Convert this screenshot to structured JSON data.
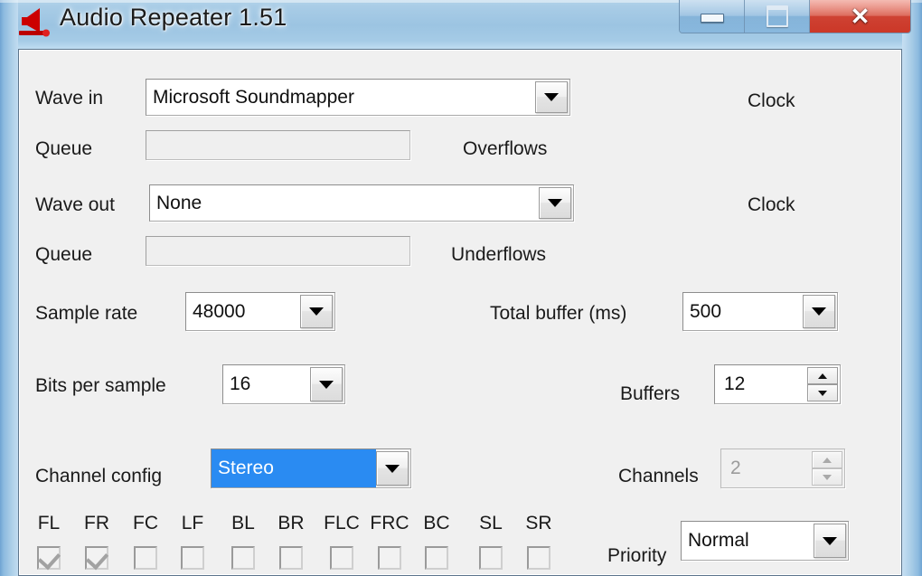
{
  "window": {
    "title": "Audio Repeater 1.51",
    "icon": "audio-repeater-icon",
    "buttons": {
      "minimize": "minimize-button",
      "maximize": "maximize-button",
      "close": "✕"
    }
  },
  "form": {
    "wave_in": {
      "label": "Wave in",
      "value": "Microsoft Soundmapper",
      "clock_label": "Clock",
      "queue_label": "Queue",
      "queue_value": "",
      "counter_label": "Overflows"
    },
    "wave_out": {
      "label": "Wave out",
      "value": "None",
      "clock_label": "Clock",
      "queue_label": "Queue",
      "queue_value": "",
      "counter_label": "Underflows"
    },
    "sample_rate": {
      "label": "Sample rate",
      "value": "48000"
    },
    "total_buffer": {
      "label": "Total buffer (ms)",
      "value": "500"
    },
    "bits_per_sample": {
      "label": "Bits per sample",
      "value": "16"
    },
    "buffers": {
      "label": "Buffers",
      "value": "12"
    },
    "channel_config": {
      "label": "Channel config",
      "value": "Stereo"
    },
    "channels": {
      "label": "Channels",
      "value": "2"
    },
    "priority": {
      "label": "Priority",
      "value": "Normal"
    },
    "channel_mask": {
      "items": [
        {
          "label": "FL",
          "checked": true
        },
        {
          "label": "FR",
          "checked": true
        },
        {
          "label": "FC",
          "checked": false
        },
        {
          "label": "LF",
          "checked": false
        },
        {
          "label": "BL",
          "checked": false
        },
        {
          "label": "BR",
          "checked": false
        },
        {
          "label": "FLC",
          "checked": false
        },
        {
          "label": "FRC",
          "checked": false
        },
        {
          "label": "BC",
          "checked": false
        },
        {
          "label": "SL",
          "checked": false
        },
        {
          "label": "SR",
          "checked": false
        }
      ]
    }
  },
  "colors": {
    "selection_blue": "#2a8bf2",
    "dialog_bg": "#f0f0f0",
    "icon_red": "#cc0000",
    "close_red": "#c42d1c"
  }
}
